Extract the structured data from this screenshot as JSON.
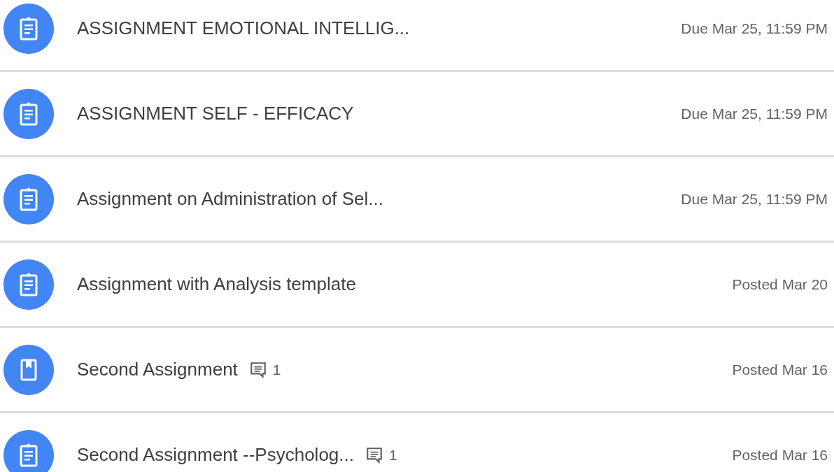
{
  "items": [
    {
      "kind": "assignment",
      "title": "ASSIGNMENT EMOTIONAL INTELLIG...",
      "date": "Due Mar 25, 11:59 PM"
    },
    {
      "kind": "assignment",
      "title": "ASSIGNMENT SELF - EFFICACY",
      "date": "Due Mar 25, 11:59 PM"
    },
    {
      "kind": "assignment",
      "title": "Assignment on Administration of Sel...",
      "date": "Due Mar 25, 11:59 PM"
    },
    {
      "kind": "assignment",
      "title": "Assignment with Analysis template",
      "date": "Posted Mar 20"
    },
    {
      "kind": "material",
      "title": "Second Assignment",
      "comments": "1",
      "date": "Posted Mar 16"
    },
    {
      "kind": "assignment",
      "title": "Second Assignment --Psycholog...",
      "comments": "1",
      "date": "Posted Mar 16"
    }
  ]
}
